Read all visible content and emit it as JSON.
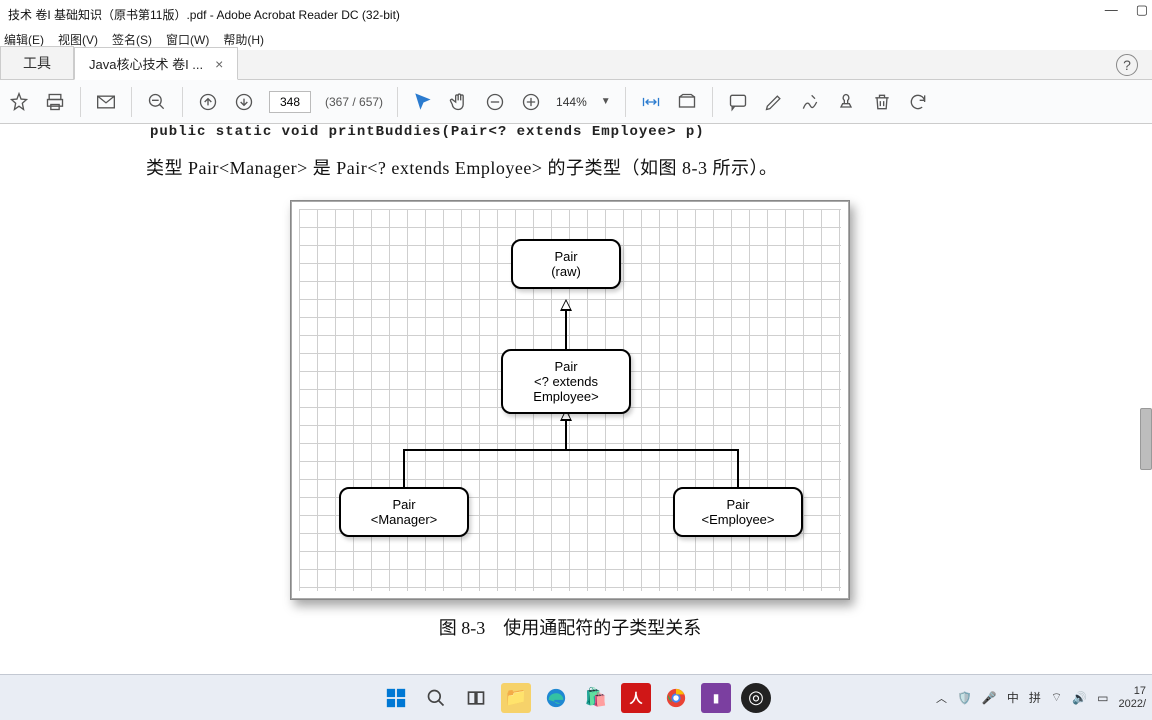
{
  "window": {
    "title": "技术 卷I 基础知识（原书第11版）.pdf - Adobe Acrobat Reader DC (32-bit)"
  },
  "menu": {
    "edit": "编辑(E)",
    "view": "视图(V)",
    "sign": "签名(S)",
    "window": "窗口(W)",
    "help": "帮助(H)"
  },
  "tabs": {
    "tools": "工具",
    "doc": "Java核心技术 卷I ..."
  },
  "toolbar": {
    "page": "348",
    "page_total": "(367 / 657)",
    "zoom": "144%"
  },
  "content": {
    "code": "public static void printBuddies(Pair<? extends Employee> p)",
    "body": "类型 Pair<Manager> 是 Pair<? extends Employee> 的子类型（如图 8-3 所示）。",
    "caption": "图 8-3　使用通配符的子类型关系"
  },
  "diagram": {
    "raw_l1": "Pair",
    "raw_l2": "(raw)",
    "ext_l1": "Pair",
    "ext_l2": "<? extends",
    "ext_l3": "Employee>",
    "mgr_l1": "Pair",
    "mgr_l2": "<Manager>",
    "emp_l1": "Pair",
    "emp_l2": "<Employee>"
  },
  "tray": {
    "ime1": "中",
    "ime2": "拼",
    "time": "17",
    "date": "2022/"
  }
}
